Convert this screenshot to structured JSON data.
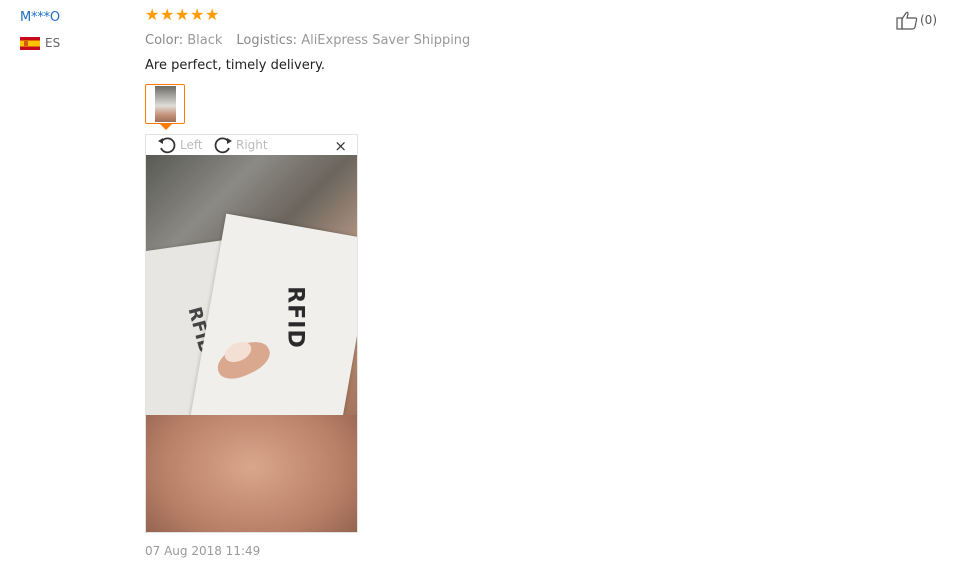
{
  "review": {
    "user_name": "M***O",
    "country_code": "ES",
    "rating": 5,
    "color_label": "Color:",
    "color_value": "Black",
    "logistics_label": "Logistics:",
    "logistics_value": "AliExpress Saver Shipping",
    "text": "Are perfect, timely delivery.",
    "date": "07 Aug 2018 11:49",
    "helpful_count": "(0)"
  },
  "viewer": {
    "rotate_left_label": "Left",
    "rotate_right_label": "Right",
    "close_label": "×"
  },
  "photo": {
    "card_text": "RFID",
    "card_small_text": "RFID"
  },
  "colors": {
    "star": "#ff9a00",
    "user_link": "#1e70c3",
    "thumb_border": "#ff7a00"
  }
}
